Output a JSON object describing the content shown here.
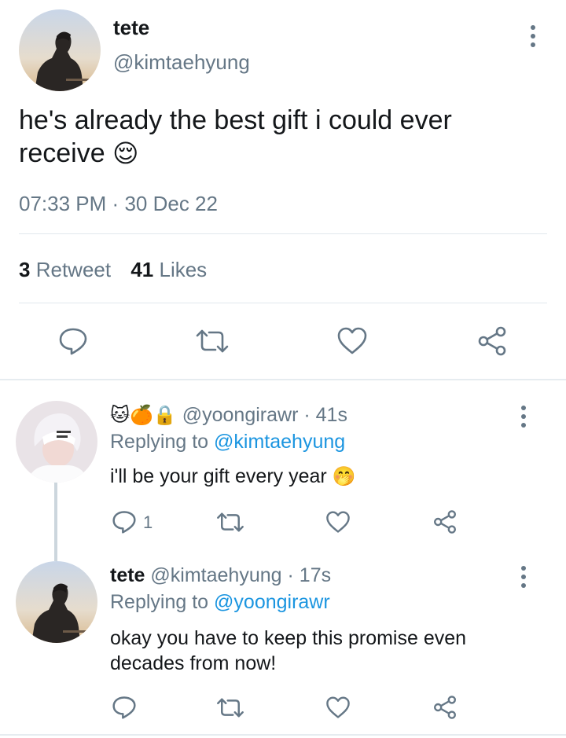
{
  "main_tweet": {
    "display_name": "tete",
    "handle": "@kimtaehyung",
    "text_line1": "he's already the best gift i could ever",
    "text_line2": "receive",
    "emoji": "😌",
    "time": "07:33 PM",
    "separator": "·",
    "date": "30 Dec 22",
    "retweet_count": "3",
    "retweet_label": "Retweet",
    "likes_count": "41",
    "likes_label": "Likes"
  },
  "replies": [
    {
      "name_emojis": "🐱🍊🔒",
      "handle": "@yoongirawr",
      "separator": "·",
      "time": "41s",
      "replying_label": "Replying to",
      "replying_to": "@kimtaehyung",
      "text": "i'll be your gift every year",
      "emoji": "🤭",
      "reply_count": "1"
    },
    {
      "display_name": "tete",
      "handle": "@kimtaehyung",
      "separator": "·",
      "time": "17s",
      "replying_label": "Replying to",
      "replying_to": "@yoongirawr",
      "text_line1": "okay you have to keep this promise even",
      "text_line2": "decades from now!"
    }
  ],
  "icons": [
    "reply-icon",
    "retweet-icon",
    "like-icon",
    "share-icon",
    "more-options-icon",
    "lock-icon"
  ],
  "colors": {
    "text": "#14171a",
    "secondary": "#657786",
    "link": "#1b95e0",
    "divider": "#e1e8ed"
  }
}
